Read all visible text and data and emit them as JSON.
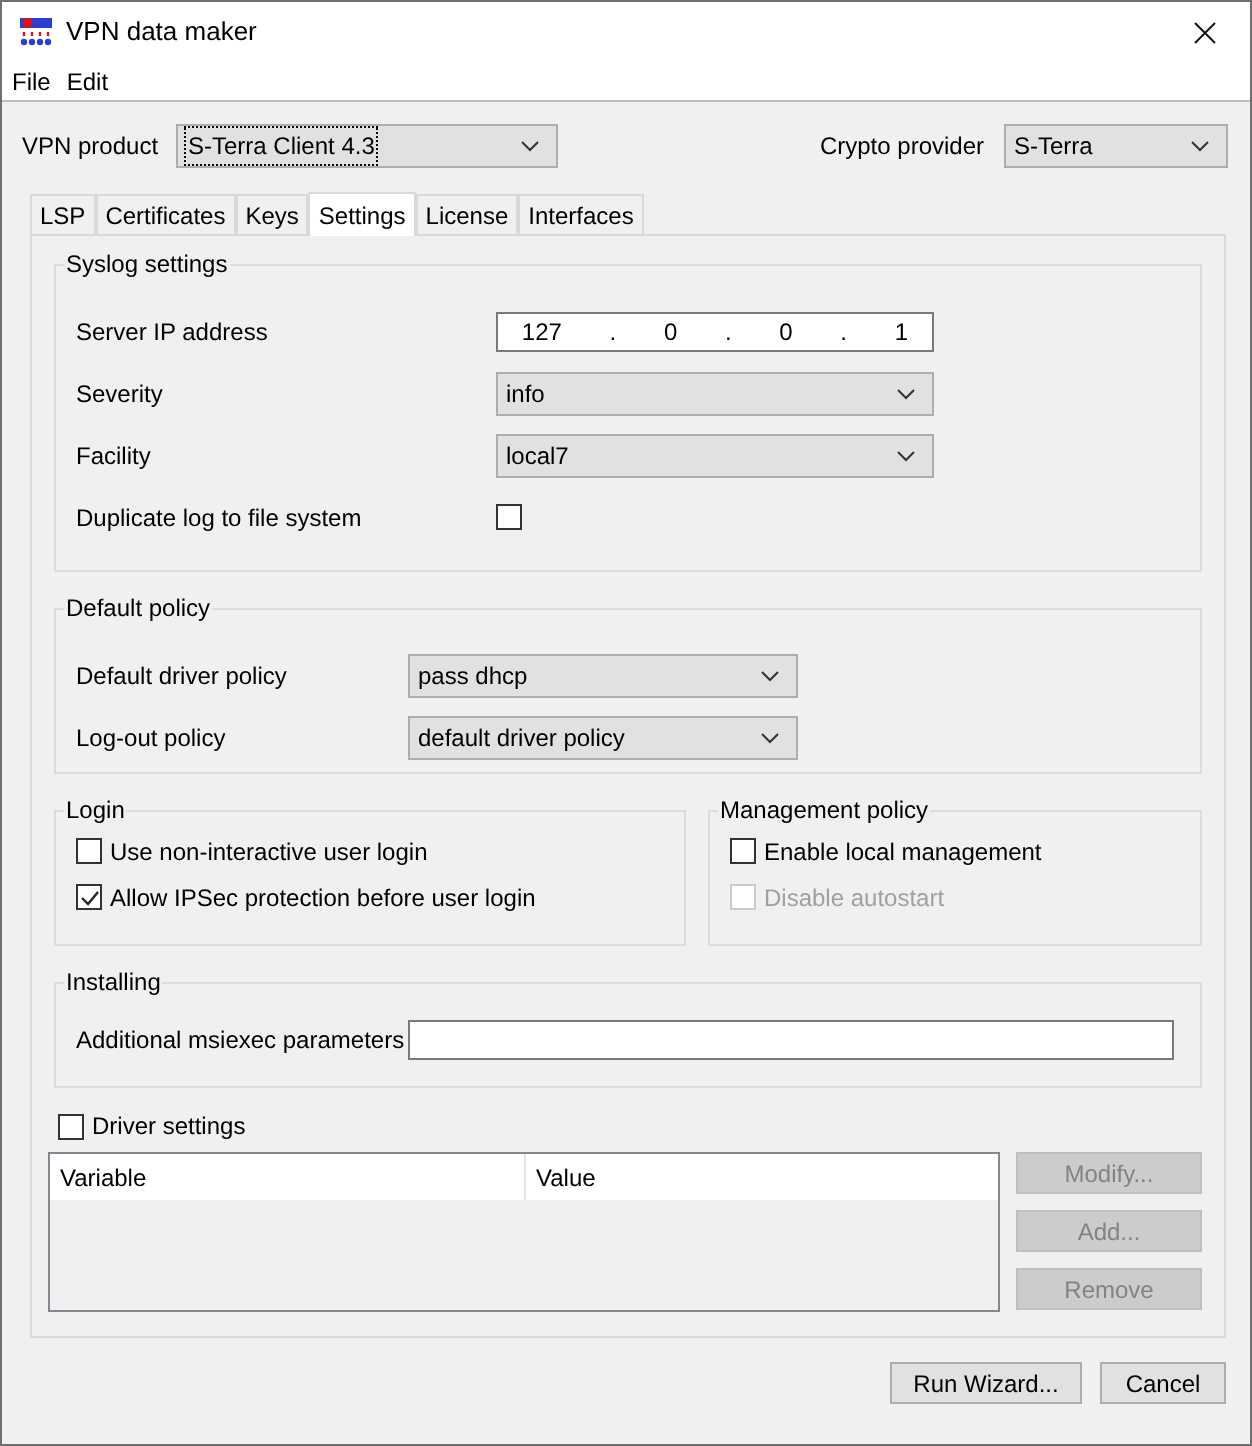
{
  "window": {
    "title": "VPN data maker"
  },
  "menu": [
    {
      "label": "File"
    },
    {
      "label": "Edit"
    }
  ],
  "vpn_product": {
    "label": "VPN product",
    "value": "S-Terra Client 4.3"
  },
  "crypto_provider": {
    "label": "Crypto provider",
    "value": "S-Terra"
  },
  "tabs": [
    {
      "label": "LSP",
      "selected": false
    },
    {
      "label": "Certificates",
      "selected": false
    },
    {
      "label": "Keys",
      "selected": false
    },
    {
      "label": "Settings",
      "selected": true
    },
    {
      "label": "License",
      "selected": false
    },
    {
      "label": "Interfaces",
      "selected": false
    }
  ],
  "syslog": {
    "title": "Syslog settings",
    "rows": [
      {
        "kind": "ip",
        "label": "Server IP address",
        "octets": [
          "127",
          "0",
          "0",
          "1"
        ],
        "separator": "."
      },
      {
        "kind": "select",
        "label": "Severity",
        "value": "info"
      },
      {
        "kind": "select",
        "label": "Facility",
        "value": "local7"
      },
      {
        "kind": "checkbox",
        "label": "Duplicate log to file system",
        "checked": false
      }
    ]
  },
  "default_policy": {
    "title": "Default policy",
    "rows": [
      {
        "kind": "select",
        "label": "Default driver policy",
        "value": "pass dhcp"
      },
      {
        "kind": "select",
        "label": "Log-out policy",
        "value": "default driver policy"
      }
    ]
  },
  "login": {
    "title": "Login",
    "options": [
      {
        "label": "Use non-interactive user login",
        "checked": false,
        "disabled": false
      },
      {
        "label": "Allow IPSec protection before user login",
        "checked": true,
        "disabled": false
      }
    ]
  },
  "management_policy": {
    "title": "Management policy",
    "options": [
      {
        "label": "Enable local management",
        "checked": false,
        "disabled": false
      },
      {
        "label": "Disable autostart",
        "checked": false,
        "disabled": true
      }
    ]
  },
  "installing": {
    "title": "Installing",
    "label": "Additional msiexec parameters"
  },
  "driver_settings": {
    "label": "Driver settings",
    "checked": false
  },
  "table": {
    "columns": [
      "Variable",
      "Value"
    ]
  },
  "side_buttons": [
    {
      "label": "Modify...",
      "disabled": true
    },
    {
      "label": "Add...",
      "disabled": true
    },
    {
      "label": "Remove",
      "disabled": true
    }
  ],
  "footer_buttons": [
    {
      "label": "Run Wizard...",
      "disabled": false
    },
    {
      "label": "Cancel",
      "disabled": false
    }
  ]
}
